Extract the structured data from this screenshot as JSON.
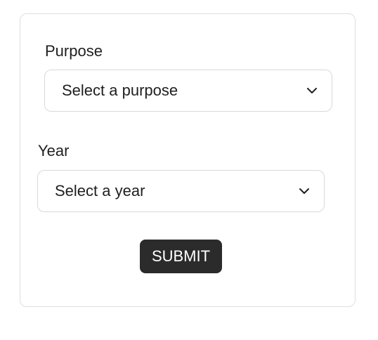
{
  "form": {
    "purpose": {
      "label": "Purpose",
      "selected": "Select a purpose",
      "icon": "chevron-down-icon"
    },
    "year": {
      "label": "Year",
      "selected": "Select a year",
      "icon": "chevron-down-icon"
    },
    "submit_label": "SUBMIT",
    "colors": {
      "button_bg": "#2b2b2b",
      "button_text": "#ffffff",
      "border": "#d9d9d9",
      "text": "#1f1f1f"
    }
  }
}
